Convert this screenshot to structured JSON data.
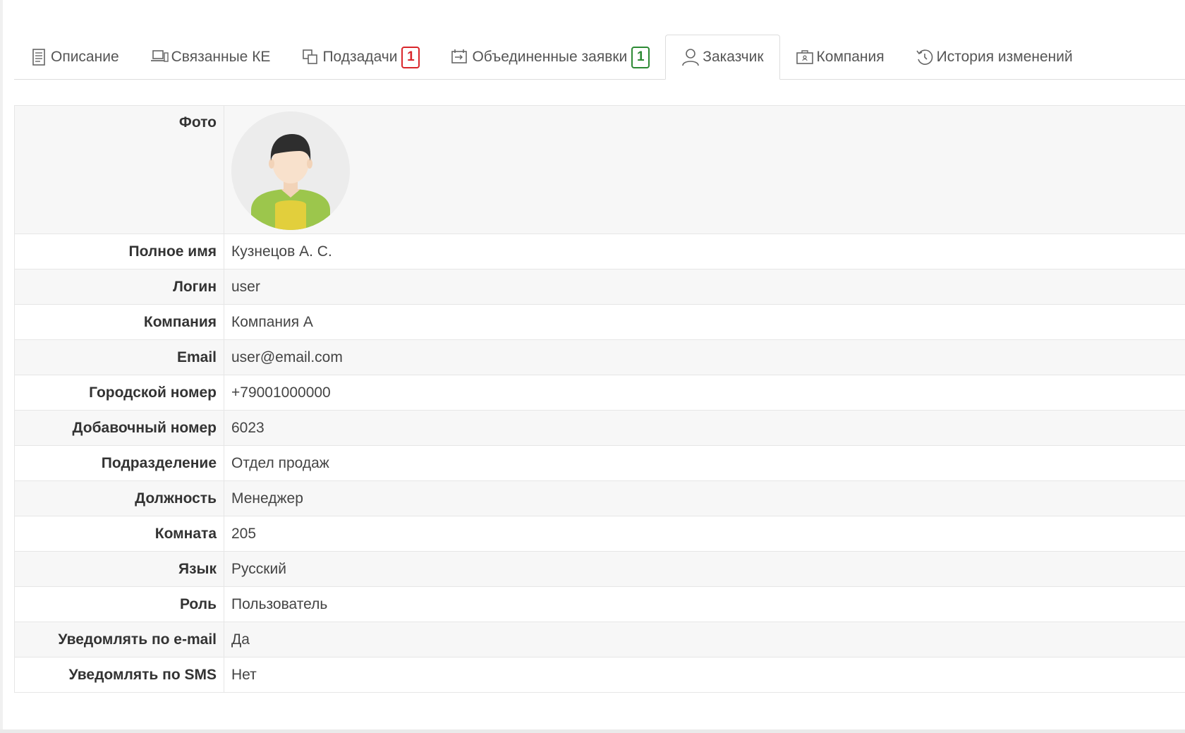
{
  "tabs": [
    {
      "label": "Описание",
      "icon": "document-icon",
      "active": false
    },
    {
      "label": "Связанные КЕ",
      "icon": "devices-icon",
      "active": false
    },
    {
      "label": "Подзадачи",
      "icon": "subtasks-icon",
      "active": false,
      "badge": "1",
      "badge_color": "#d9262b"
    },
    {
      "label": "Объединенные заявки",
      "icon": "merge-icon",
      "active": false,
      "badge": "1",
      "badge_color": "#2d8a34"
    },
    {
      "label": "Заказчик",
      "icon": "user-icon",
      "active": true
    },
    {
      "label": "Компания",
      "icon": "company-icon",
      "active": false
    },
    {
      "label": "История изменений",
      "icon": "history-icon",
      "active": false
    }
  ],
  "customer": {
    "photo_label": "Фото",
    "fields": [
      {
        "label": "Полное имя",
        "value": "Кузнецов А. С."
      },
      {
        "label": "Логин",
        "value": "user"
      },
      {
        "label": "Компания",
        "value": "Компания А"
      },
      {
        "label": "Email",
        "value": "user@email.com"
      },
      {
        "label": "Городской номер",
        "value": "+79001000000"
      },
      {
        "label": "Добавочный номер",
        "value": "6023"
      },
      {
        "label": "Подразделение",
        "value": "Отдел продаж"
      },
      {
        "label": "Должность",
        "value": "Менеджер"
      },
      {
        "label": "Комната",
        "value": "205"
      },
      {
        "label": "Язык",
        "value": "Русский"
      },
      {
        "label": "Роль",
        "value": "Пользователь"
      },
      {
        "label": "Уведомлять по e-mail",
        "value": "Да"
      },
      {
        "label": "Уведомлять по SMS",
        "value": "Нет"
      }
    ]
  }
}
